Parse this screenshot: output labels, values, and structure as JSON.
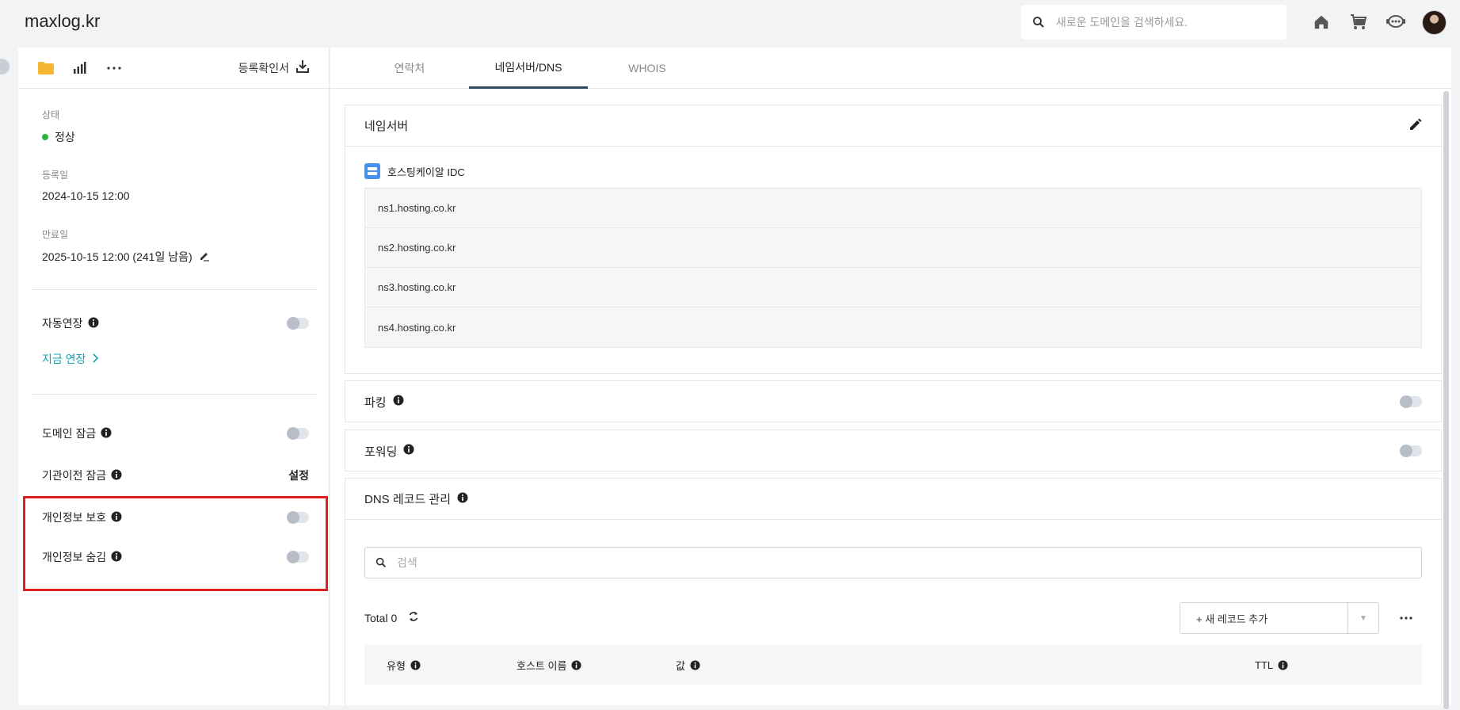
{
  "header": {
    "title": "maxlog.kr",
    "search_placeholder": "새로운 도메인을 검색하세요.",
    "icons": [
      "home-icon",
      "cart-icon",
      "support-chat-icon",
      "avatar"
    ]
  },
  "left_toolbar": {
    "icons": [
      "folder-icon",
      "stats-icon",
      "more-icon"
    ],
    "cert_label": "등록확인서"
  },
  "info": {
    "status_label": "상태",
    "status_value": "정상",
    "registered_label": "등록일",
    "registered_value": "2024-10-15 12:00",
    "expiry_label": "만료일",
    "expiry_value": "2025-10-15 12:00 (241일 남음)"
  },
  "renew": {
    "auto_label": "자동연장",
    "now_label": "지금 연장"
  },
  "locks": {
    "domain_lock": "도메인 잠금",
    "transfer_lock": "기관이전 잠금",
    "transfer_action": "설정",
    "privacy_protect": "개인정보 보호",
    "privacy_hide": "개인정보 숨김"
  },
  "tabs": [
    {
      "label": "연락처",
      "active": false
    },
    {
      "label": "네임서버/DNS",
      "active": true
    },
    {
      "label": "WHOIS",
      "active": false
    }
  ],
  "nameserver": {
    "title": "네임서버",
    "provider": "호스팅케이알 IDC",
    "servers": [
      "ns1.hosting.co.kr",
      "ns2.hosting.co.kr",
      "ns3.hosting.co.kr",
      "ns4.hosting.co.kr"
    ]
  },
  "parking": {
    "title": "파킹"
  },
  "forwarding": {
    "title": "포워딩"
  },
  "dns": {
    "title": "DNS 레코드 관리",
    "search_placeholder": "검색",
    "total": "Total 0",
    "add_label": "+ 새 레코드 추가",
    "columns": [
      "유형",
      "호스트 이름",
      "값",
      "TTL"
    ]
  },
  "colors": {
    "accent_link": "#12a3b0",
    "status_dot": "#2eb140",
    "highlight": "#e02020",
    "tab_indicator": "#2e4a5e"
  }
}
